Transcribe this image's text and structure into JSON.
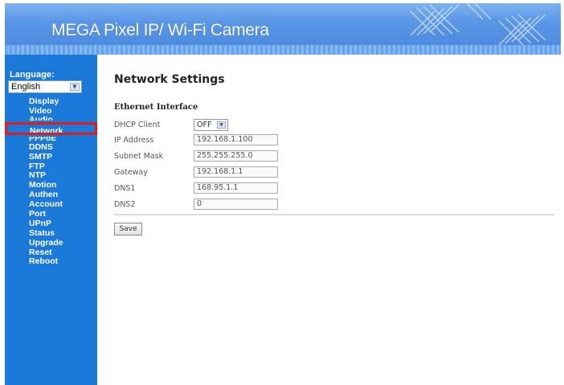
{
  "header": {
    "title": "MEGA Pixel IP/ Wi-Fi Camera"
  },
  "sidebar": {
    "language_label": "Language:",
    "language_value": "English",
    "menu": {
      "display": "Display",
      "video": "Video",
      "audio": "Audio",
      "network": "Network",
      "pppoe": "PPPoE",
      "ddns": "DDNS",
      "smtp": "SMTP",
      "ftp": "FTP",
      "ntp": "NTP",
      "motion": "Motion",
      "authen": "Authen",
      "account": "Account",
      "port": "Port",
      "upnp": "UPnP",
      "status": "Status",
      "upgrade": "Upgrade",
      "reset": "Reset",
      "reboot": "Reboot"
    }
  },
  "main": {
    "title": "Network Settings",
    "section": "Ethernet Interface",
    "dhcp": {
      "label": "DHCP Client",
      "value": "OFF"
    },
    "ip": {
      "label": "IP Address",
      "value": "192.168.1.100"
    },
    "subnet": {
      "label": "Subnet Mask",
      "value": "255.255.255.0"
    },
    "gateway": {
      "label": "Gateway",
      "value": "192.168.1.1"
    },
    "dns1": {
      "label": "DNS1",
      "value": "168.95.1.1"
    },
    "dns2": {
      "label": "DNS2",
      "value": "0"
    },
    "save_label": "Save"
  },
  "colors": {
    "sidebar": "#1b79d9",
    "header": "#5b97e6",
    "highlight": "#e41c1c"
  },
  "icons": {
    "dropdown": "chevron-down-icon"
  }
}
